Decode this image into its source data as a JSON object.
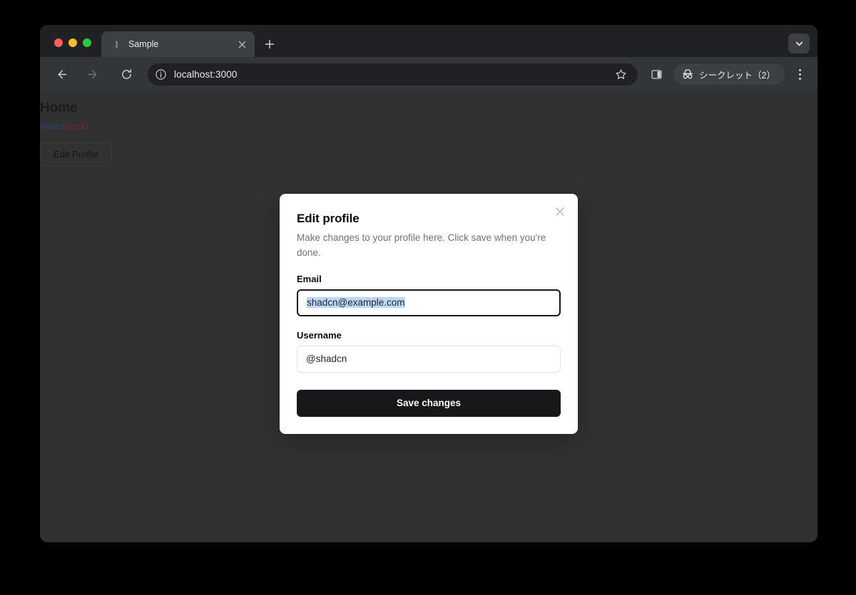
{
  "browser": {
    "tab": {
      "title": "Sample",
      "favicon": "globe-icon",
      "close_label": "×"
    },
    "new_tab_label": "+",
    "toolbar": {
      "back_icon": "arrow-left-icon",
      "forward_icon": "arrow-right-icon",
      "reload_icon": "reload-icon",
      "url": "localhost:3000",
      "site_info_icon": "info-circle-icon",
      "bookmark_icon": "star-icon",
      "side_panel_icon": "side-panel-icon",
      "incognito_label": "シークレット（2）",
      "incognito_icon": "incognito-icon",
      "menu_icon": "three-dots-vertical-icon"
    },
    "tab_list_icon": "chevron-down-icon",
    "traffic_lights": {
      "close": "#ff5f57",
      "minimize": "#febc2e",
      "maximize": "#28c840"
    }
  },
  "page": {
    "heading": "Home",
    "hello": "Hello",
    "world": "World",
    "edit_profile_button": "Edit Profile",
    "background_color": "#313131",
    "hello_color": "#2f4270",
    "world_color": "#6b2b2b"
  },
  "dialog": {
    "title": "Edit profile",
    "description": "Make changes to your profile here. Click save when you're done.",
    "close_icon": "close-icon",
    "fields": [
      {
        "label": "Email",
        "value": "shadcn@example.com",
        "focused": true,
        "selected": true
      },
      {
        "label": "Username",
        "value": "@shadcn",
        "focused": false,
        "selected": false
      }
    ],
    "save_button": "Save changes",
    "accent_color": "#18181b",
    "selection_color": "#bcd7f7"
  }
}
